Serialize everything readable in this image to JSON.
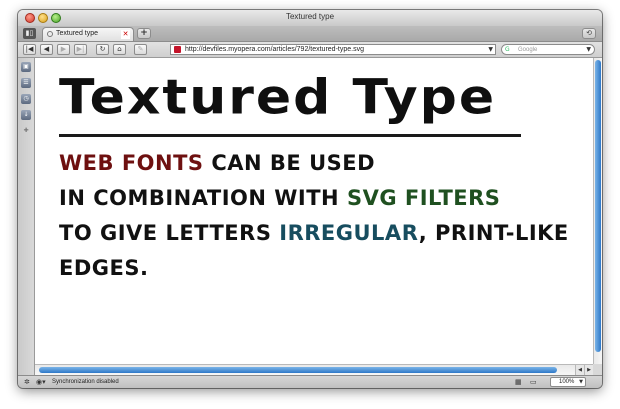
{
  "window": {
    "title": "Textured type"
  },
  "tabs": [
    {
      "label": "Textured type",
      "active": true
    }
  ],
  "tabbar": {
    "new_tab_icon": "+",
    "trash_icon": "⟲"
  },
  "navigation": {
    "back_icon": "◀",
    "forward_icon": "▶",
    "fastforward_icon": "▶|",
    "rewind_icon": "|◀",
    "reload_icon": "↻",
    "home_icon": "⌂",
    "wand_icon": "✎"
  },
  "address": {
    "url": "http://devfiles.myopera.com/articles/792/textured-type.svg",
    "dropdown_icon": "▼"
  },
  "search": {
    "placeholder": "Google",
    "engine_icon": "G",
    "dropdown_icon": "▼"
  },
  "sidebar": {
    "items": [
      {
        "icon": "▣"
      },
      {
        "icon": "☰"
      },
      {
        "icon": "◷"
      },
      {
        "icon": "↓"
      },
      {
        "icon": "✚"
      }
    ]
  },
  "page": {
    "heading": "Textured Type",
    "lines": [
      {
        "highlight": "Web fonts",
        "rest": " can be used"
      },
      {
        "prefix": "in combination with ",
        "highlight": "SVG filters"
      },
      {
        "prefix": "to give letters ",
        "highlight": "irregular",
        "rest": ", print-like"
      },
      {
        "prefix": "edges."
      }
    ]
  },
  "status": {
    "sync_text": "Synchronization disabled",
    "zoom": "100%",
    "zoom_dropdown_icon": "▼"
  },
  "colors": {
    "highlight_red": "#6e1010",
    "highlight_green": "#1f5020",
    "highlight_teal": "#174d5f",
    "scrollbar_accent": "#2e78c8"
  }
}
